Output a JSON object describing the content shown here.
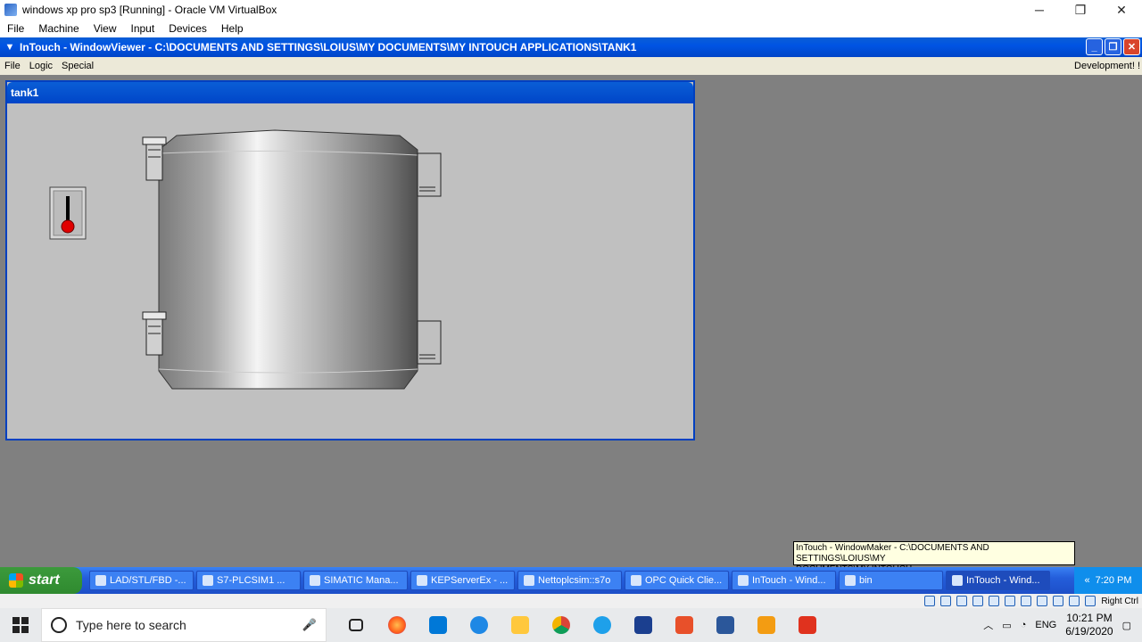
{
  "vbox": {
    "title": "windows xp pro sp3  [Running] - Oracle VM VirtualBox",
    "menu": [
      "File",
      "Machine",
      "View",
      "Input",
      "Devices",
      "Help"
    ],
    "controls": {
      "minimize": "─",
      "restore": "❐",
      "close": "✕"
    },
    "status_host_key": "Right Ctrl"
  },
  "intouch": {
    "title": "InTouch - WindowViewer - C:\\DOCUMENTS AND SETTINGS\\LOIUS\\MY DOCUMENTS\\MY INTOUCH APPLICATIONS\\TANK1",
    "menu": [
      "File",
      "Logic",
      "Special"
    ],
    "right_menu": "Development! !",
    "controls": {
      "minimize": "_",
      "restore": "❐",
      "close": "✕"
    }
  },
  "tank_window": {
    "title": "tank1",
    "colors": {
      "frame": "#0040c0",
      "background": "#c0c0c0",
      "tank_light": "#f4f4f4",
      "tank_dark": "#6e6e6e",
      "indicator": "#e00000"
    }
  },
  "xp_taskbar": {
    "start_label": "start",
    "items": [
      {
        "label": "LAD/STL/FBD  -..."
      },
      {
        "label": "S7-PLCSIM1    ..."
      },
      {
        "label": "SIMATIC Mana..."
      },
      {
        "label": "KEPServerEx - ..."
      },
      {
        "label": "Nettoplcsim::s7o"
      },
      {
        "label": "OPC Quick Clie..."
      },
      {
        "label": "InTouch - Wind..."
      },
      {
        "label": "bin"
      },
      {
        "label": "InTouch - Wind..."
      }
    ],
    "clock": "7:20 PM"
  },
  "tooltip": {
    "line1": "InTouch - WindowMaker - C:\\DOCUMENTS AND SETTINGS\\LOIUS\\MY",
    "line2": "DOCUMENTS\\MY INTOUCH"
  },
  "win10_taskbar": {
    "search_placeholder": "Type here to search",
    "pinned_icons": [
      "task-view-icon",
      "firefox-icon",
      "store-icon",
      "edge-icon",
      "file-explorer-icon",
      "chrome-icon",
      "ie-icon",
      "virtualbox-icon",
      "office-icon",
      "word-icon",
      "gitmind-icon",
      "app-red-icon"
    ],
    "tray_lang": "ENG",
    "time": "10:21 PM",
    "date": "6/19/2020"
  }
}
